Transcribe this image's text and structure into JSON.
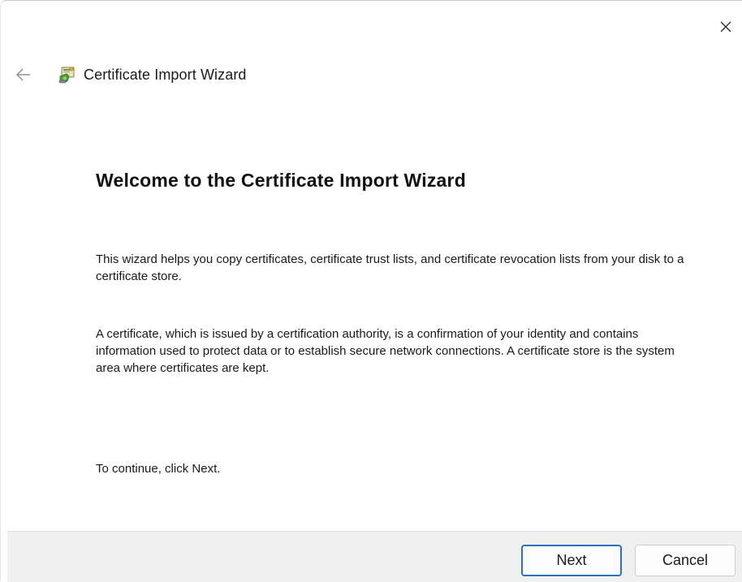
{
  "window": {
    "title": "Certificate Import Wizard"
  },
  "icons": {
    "close": "close-icon",
    "back": "back-arrow-icon",
    "wizard": "certificate-wizard-icon"
  },
  "content": {
    "heading": "Welcome to the Certificate Import Wizard",
    "paragraph1": "This wizard helps you copy certificates, certificate trust lists, and certificate revocation lists from your disk to a certificate store.",
    "paragraph2": "A certificate, which is issued by a certification authority, is a confirmation of your identity and contains information used to protect data or to establish secure network connections. A certificate store is the system area where certificates are kept.",
    "paragraph3": "To continue, click Next."
  },
  "footer": {
    "next_label": "Next",
    "cancel_label": "Cancel"
  },
  "colors": {
    "accent": "#2f6fc2",
    "footer_bg": "#f0f0f0"
  }
}
